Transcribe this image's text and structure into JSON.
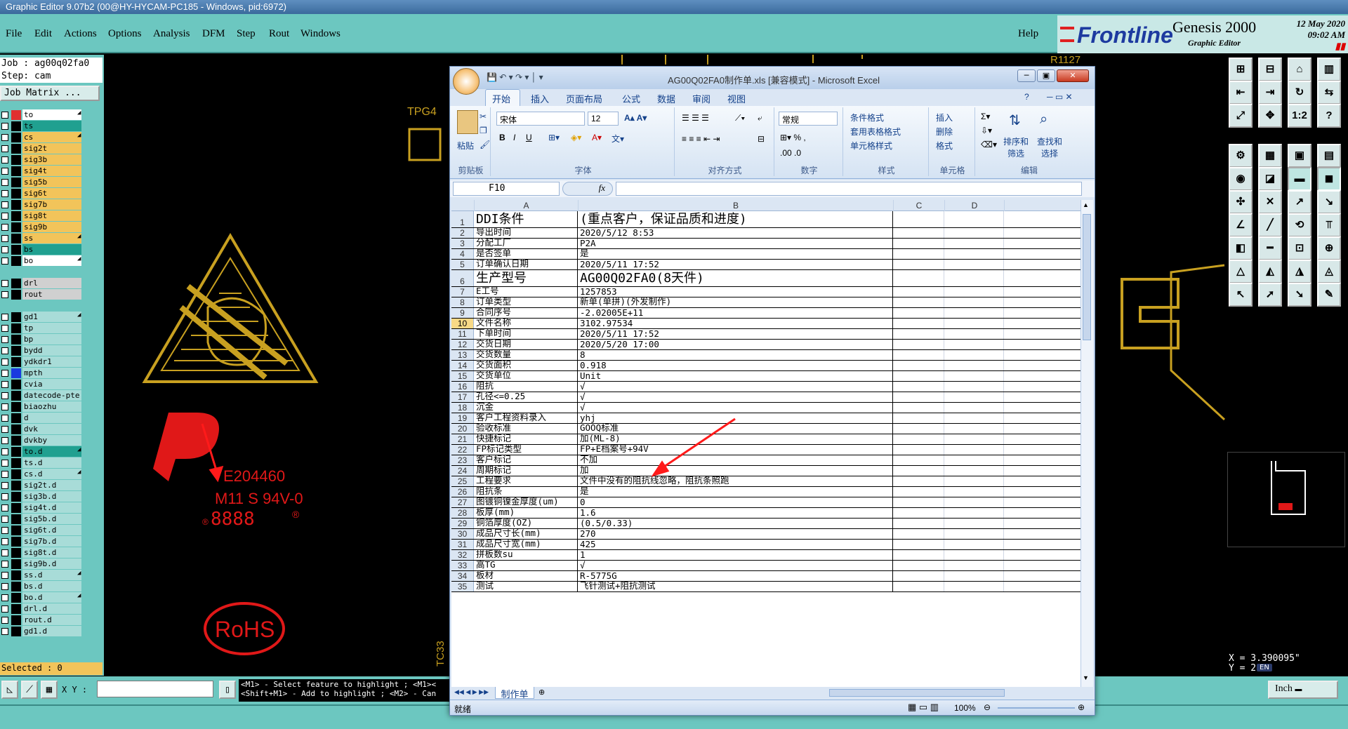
{
  "genesis": {
    "title": "Graphic Editor 9.07b2 (00@HY-HYCAM-PC185 - Windows, pid:6972)",
    "menu": [
      "File",
      "Edit",
      "Actions",
      "Options",
      "Analysis",
      "DFM",
      "Step",
      "Rout",
      "Windows"
    ],
    "help": "Help",
    "brand": "Frontline",
    "product": "Genesis 2000",
    "product_sub": "Graphic Editor",
    "date": "12 May 2020",
    "time": "09:02 AM",
    "job_line": "Job : ag00q02fa0",
    "step_line": "Step: cam",
    "job_matrix": "Job Matrix ...",
    "selected": "Selected : 0",
    "xy_label": "X Y :",
    "hint_1": "<M1> - Select feature to highlight ; <M1><",
    "hint_2": "<Shift+M1> - Add to highlight ; <M2> - Can",
    "units": "Inch",
    "coord_x": "X = 3.390095\"",
    "coord_y": "Y = 2",
    "ime": "EN",
    "layers": [
      {
        "name": "to",
        "bg": "#ffffff",
        "sq": "#e03030",
        "arrow": "◢"
      },
      {
        "name": "ts",
        "bg": "#20a090",
        "sq": "#000000",
        "arrow": ""
      },
      {
        "name": "cs",
        "bg": "#f2c45a",
        "sq": "#000000",
        "arrow": "◢"
      },
      {
        "name": "sig2t",
        "bg": "#f2c45a",
        "sq": "#000000",
        "arrow": ""
      },
      {
        "name": "sig3b",
        "bg": "#f2c45a",
        "sq": "#000000",
        "arrow": ""
      },
      {
        "name": "sig4t",
        "bg": "#f2c45a",
        "sq": "#000000",
        "arrow": ""
      },
      {
        "name": "sig5b",
        "bg": "#f2c45a",
        "sq": "#000000",
        "arrow": ""
      },
      {
        "name": "sig6t",
        "bg": "#f2c45a",
        "sq": "#000000",
        "arrow": ""
      },
      {
        "name": "sig7b",
        "bg": "#f2c45a",
        "sq": "#000000",
        "arrow": ""
      },
      {
        "name": "sig8t",
        "bg": "#f2c45a",
        "sq": "#000000",
        "arrow": ""
      },
      {
        "name": "sig9b",
        "bg": "#f2c45a",
        "sq": "#000000",
        "arrow": ""
      },
      {
        "name": "ss",
        "bg": "#f2c45a",
        "sq": "#000000",
        "arrow": "◢"
      },
      {
        "name": "bs",
        "bg": "#20a090",
        "sq": "#000000",
        "arrow": ""
      },
      {
        "name": "bo",
        "bg": "#ffffff",
        "sq": "#000000",
        "arrow": "◢"
      },
      {
        "name": "",
        "bg": "#6cc7c0",
        "sq": "#6cc7c0",
        "arrow": ""
      },
      {
        "name": "drl",
        "bg": "#d0d0d0",
        "sq": "#000000",
        "arrow": ""
      },
      {
        "name": "rout",
        "bg": "#d0d0d0",
        "sq": "#000000",
        "arrow": ""
      },
      {
        "name": "",
        "bg": "#6cc7c0",
        "sq": "#6cc7c0",
        "arrow": ""
      },
      {
        "name": "gd1",
        "bg": "#a8dcd8",
        "sq": "#000000",
        "arrow": "◢"
      },
      {
        "name": "tp",
        "bg": "#a8dcd8",
        "sq": "#000000",
        "arrow": ""
      },
      {
        "name": "bp",
        "bg": "#a8dcd8",
        "sq": "#000000",
        "arrow": ""
      },
      {
        "name": "bydd",
        "bg": "#a8dcd8",
        "sq": "#000000",
        "arrow": ""
      },
      {
        "name": "ydkdr1",
        "bg": "#a8dcd8",
        "sq": "#000000",
        "arrow": ""
      },
      {
        "name": "mpth",
        "bg": "#a8dcd8",
        "sq": "#1a3ae0",
        "arrow": ""
      },
      {
        "name": "cvia",
        "bg": "#a8dcd8",
        "sq": "#000000",
        "arrow": ""
      },
      {
        "name": "datecode-pte",
        "bg": "#a8dcd8",
        "sq": "#000000",
        "arrow": ""
      },
      {
        "name": "biaozhu",
        "bg": "#a8dcd8",
        "sq": "#000000",
        "arrow": ""
      },
      {
        "name": "d",
        "bg": "#a8dcd8",
        "sq": "#000000",
        "arrow": ""
      },
      {
        "name": "dvk",
        "bg": "#a8dcd8",
        "sq": "#000000",
        "arrow": ""
      },
      {
        "name": "dvkby",
        "bg": "#a8dcd8",
        "sq": "#000000",
        "arrow": ""
      },
      {
        "name": "to.d",
        "bg": "#20a090",
        "sq": "#000000",
        "arrow": "◢"
      },
      {
        "name": "ts.d",
        "bg": "#a8dcd8",
        "sq": "#000000",
        "arrow": ""
      },
      {
        "name": "cs.d",
        "bg": "#a8dcd8",
        "sq": "#000000",
        "arrow": "◢"
      },
      {
        "name": "sig2t.d",
        "bg": "#a8dcd8",
        "sq": "#000000",
        "arrow": ""
      },
      {
        "name": "sig3b.d",
        "bg": "#a8dcd8",
        "sq": "#000000",
        "arrow": ""
      },
      {
        "name": "sig4t.d",
        "bg": "#a8dcd8",
        "sq": "#000000",
        "arrow": ""
      },
      {
        "name": "sig5b.d",
        "bg": "#a8dcd8",
        "sq": "#000000",
        "arrow": ""
      },
      {
        "name": "sig6t.d",
        "bg": "#a8dcd8",
        "sq": "#000000",
        "arrow": ""
      },
      {
        "name": "sig7b.d",
        "bg": "#a8dcd8",
        "sq": "#000000",
        "arrow": ""
      },
      {
        "name": "sig8t.d",
        "bg": "#a8dcd8",
        "sq": "#000000",
        "arrow": ""
      },
      {
        "name": "sig9b.d",
        "bg": "#a8dcd8",
        "sq": "#000000",
        "arrow": ""
      },
      {
        "name": "ss.d",
        "bg": "#a8dcd8",
        "sq": "#000000",
        "arrow": "◢"
      },
      {
        "name": "bs.d",
        "bg": "#a8dcd8",
        "sq": "#000000",
        "arrow": ""
      },
      {
        "name": "bo.d",
        "bg": "#a8dcd8",
        "sq": "#000000",
        "arrow": "◢"
      },
      {
        "name": "drl.d",
        "bg": "#a8dcd8",
        "sq": "#000000",
        "arrow": ""
      },
      {
        "name": "rout.d",
        "bg": "#a8dcd8",
        "sq": "#000000",
        "arrow": ""
      },
      {
        "name": "gd1.d",
        "bg": "#a8dcd8",
        "sq": "#000000",
        "arrow": ""
      }
    ],
    "toolbar_glyphs": [
      "⊞",
      "⊟",
      "⌂",
      "▥",
      "⇤",
      "⇥",
      "↻",
      "⇆",
      "⤢",
      "✥",
      "1:2",
      "?",
      "⚙",
      "▦",
      "▣",
      "▤",
      "◉",
      "◪",
      "▬",
      "◼",
      "✣",
      "✕",
      "↗",
      "↘",
      "∠",
      "╱",
      "⟲",
      "⫪",
      "◧",
      "━",
      "⊡",
      "⊕",
      "△",
      "◭",
      "◮",
      "◬",
      "↖",
      "➚",
      "➘",
      "✎"
    ],
    "canvas_labels": {
      "tpg4": "TPG4",
      "tc33": "TC33",
      "r1127": "R1127",
      "ul_code": "E204460",
      "ul_grade": "M11 S 94V-0",
      "ul_date": "8888",
      "rohs": "RoHS"
    }
  },
  "excel": {
    "title": "AG00Q02FA0制作单.xls [兼容模式] - Microsoft Excel",
    "tabs": [
      "开始",
      "插入",
      "页面布局",
      "公式",
      "数据",
      "审阅",
      "视图"
    ],
    "groups": [
      "剪贴板",
      "字体",
      "对齐方式",
      "数字",
      "样式",
      "单元格",
      "编辑"
    ],
    "paste": "粘贴",
    "font_name": "宋体",
    "font_size": "12",
    "number_format": "常规",
    "styles": [
      "条件格式",
      "套用表格格式",
      "单元格样式"
    ],
    "cells_btns": [
      "插入",
      "删除",
      "格式"
    ],
    "edit_btns": [
      "排序和筛选",
      "查找和选择"
    ],
    "name_box": "F10",
    "fx": "fx",
    "columns": [
      "A",
      "B",
      "C",
      "D"
    ],
    "rows": [
      {
        "n": "1",
        "a": "DDI条件",
        "b": "(重点客户，保证品质和进度)",
        "big": true
      },
      {
        "n": "2",
        "a": "导出时间",
        "b": "2020/5/12 8:53"
      },
      {
        "n": "3",
        "a": "分配工厂",
        "b": "P2A"
      },
      {
        "n": "4",
        "a": "是否签单",
        "b": "是"
      },
      {
        "n": "5",
        "a": "订单确认日期",
        "b": "2020/5/11 17:52"
      },
      {
        "n": "6",
        "a": "生产型号",
        "b": "AG00Q02FA0(8天件)",
        "big": true
      },
      {
        "n": "7",
        "a": "E工号",
        "b": "1257853"
      },
      {
        "n": "8",
        "a": "订单类型",
        "b": "新单(单拼)(外发制作)"
      },
      {
        "n": "9",
        "a": "合同序号",
        "b": "-2.02005E+11"
      },
      {
        "n": "10",
        "a": "文件名称",
        "b": "3102.97534",
        "sel": true
      },
      {
        "n": "11",
        "a": "下单时间",
        "b": "2020/5/11 17:52"
      },
      {
        "n": "12",
        "a": "交货日期",
        "b": "2020/5/20 17:00"
      },
      {
        "n": "13",
        "a": "交货数量",
        "b": "8"
      },
      {
        "n": "14",
        "a": "交货面积",
        "b": "0.918"
      },
      {
        "n": "15",
        "a": "交货单位",
        "b": "Unit"
      },
      {
        "n": "16",
        "a": "阻抗",
        "b": "√"
      },
      {
        "n": "17",
        "a": "孔径<=0.25",
        "b": "√"
      },
      {
        "n": "18",
        "a": "沉金",
        "b": "√"
      },
      {
        "n": "19",
        "a": "客户工程资料录入",
        "b": "yhj"
      },
      {
        "n": "20",
        "a": "验收标准",
        "b": "GOOQ标准"
      },
      {
        "n": "21",
        "a": "快捷标记",
        "b": "加(ML-8)"
      },
      {
        "n": "22",
        "a": "FP标记类型",
        "b": "FP+E档案号+94V"
      },
      {
        "n": "23",
        "a": "客户标记",
        "b": "不加"
      },
      {
        "n": "24",
        "a": "周期标记",
        "b": "加"
      },
      {
        "n": "25",
        "a": "工程要求",
        "b": "文件中没有的阻抗线忽略，阻抗条照跑"
      },
      {
        "n": "26",
        "a": "阻抗条",
        "b": "是"
      },
      {
        "n": "27",
        "a": "图镀铜镍金厚度(um)",
        "b": "0"
      },
      {
        "n": "28",
        "a": "板厚(mm)",
        "b": "1.6"
      },
      {
        "n": "29",
        "a": "铜箔厚度(OZ)",
        "b": "(0.5/0.33)"
      },
      {
        "n": "30",
        "a": "成品尺寸长(mm)",
        "b": "270"
      },
      {
        "n": "31",
        "a": "成品尺寸宽(mm)",
        "b": "425"
      },
      {
        "n": "32",
        "a": "拼板数su",
        "b": "1"
      },
      {
        "n": "33",
        "a": "高TG",
        "b": "√"
      },
      {
        "n": "34",
        "a": "板材",
        "b": "R-5775G"
      },
      {
        "n": "35",
        "a": "测试",
        "b": "飞针测试+阻抗测试"
      }
    ],
    "sheet_tab": "制作单",
    "status": "就绪",
    "zoom": "100%"
  }
}
